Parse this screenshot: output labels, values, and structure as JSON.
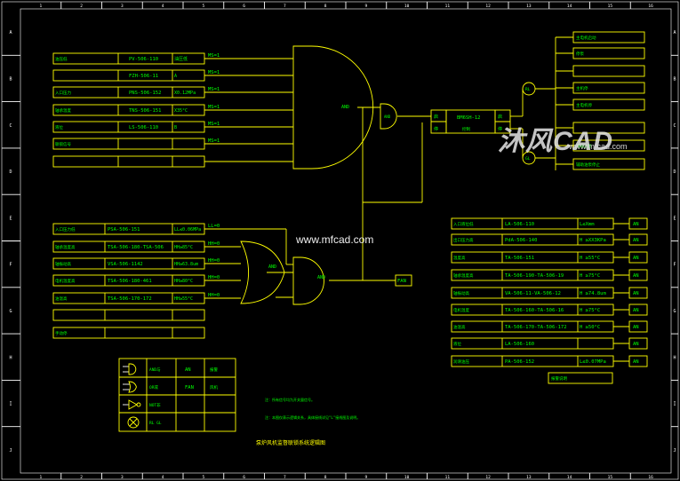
{
  "colors": {
    "background": "#000000",
    "line": "#ffff00",
    "text": "#00ff00",
    "frame": "#ffffff",
    "cyan": "#00ffff",
    "red": "#ff3030",
    "watermark": "#e8e8e8"
  },
  "border": {
    "top_numbers": [
      "1",
      "2",
      "3",
      "4",
      "5",
      "6",
      "7",
      "8",
      "9",
      "10",
      "11",
      "12",
      "13",
      "14",
      "15",
      "16"
    ],
    "bottom_numbers": [
      "1",
      "2",
      "3",
      "4",
      "5",
      "6",
      "7",
      "8",
      "9",
      "10",
      "11",
      "12",
      "13",
      "14",
      "15",
      "16"
    ],
    "side_letters": [
      "A",
      "B",
      "C",
      "D",
      "E",
      "F",
      "G",
      "H",
      "I",
      "J"
    ]
  },
  "upper_group": {
    "rows": [
      {
        "name": "油压低",
        "tag": "PV-506-110",
        "cond": "油压低",
        "ms": "MS=1"
      },
      {
        "name": "",
        "tag": "FZH-506-11",
        "cond": "A",
        "ms": "MS=1"
      },
      {
        "name": "入口压力",
        "tag": "PNS-506-152",
        "cond": "X0.12MPa",
        "ms": "MS=1"
      },
      {
        "name": "轴承温度",
        "tag": "TNS-506-151",
        "cond": "X35°C",
        "ms": "MS=1"
      },
      {
        "name": "液位",
        "tag": "LS-506-110",
        "cond": "B",
        "ms": "MS=1"
      },
      {
        "name": "联锁信号",
        "tag": "",
        "cond": "",
        "ms": "MS=1"
      },
      {
        "name": "",
        "tag": "",
        "cond": "",
        "ms": ""
      }
    ],
    "gate_label": "AND"
  },
  "lower_group": {
    "rows": [
      {
        "name": "入口压力低",
        "tag": "PSA-506-151",
        "cond": "LL≤0.06MPa",
        "ms": "LL=0"
      },
      {
        "name": "轴承温度高",
        "tag": "TSA-506-180-TSA-506",
        "cond": "HH≥85°C",
        "ms": "HH=0"
      },
      {
        "name": "轴振动高",
        "tag": "VSA-506-1142",
        "cond": "HH≥63.8um",
        "ms": "HH=0"
      },
      {
        "name": "电机温度高",
        "tag": "TSA-506-180-461",
        "cond": "HH≥80°C",
        "ms": "HH=0"
      },
      {
        "name": "油温高",
        "tag": "TSA-506-170-172",
        "cond": "HH≥55°C",
        "ms": "HH=0"
      },
      {
        "name": "",
        "tag": "",
        "cond": "",
        "ms": ""
      },
      {
        "name": "手动停",
        "tag": "",
        "cond": "",
        "ms": ""
      }
    ],
    "or_gate_label": "AND",
    "and_gate_label": "AND",
    "fan_label": "FAN"
  },
  "center": {
    "and_gate_label": "AND",
    "controller_left_top": "启",
    "controller_left_bottom": "停",
    "controller_tag": "BM6SH-12",
    "controller_sub": "控制",
    "controller_right_top": "启",
    "controller_right_bottom": "停",
    "lamp_top": "RL",
    "lamp_bottom": "GL"
  },
  "output_list": [
    "主电机启动",
    "停泵",
    "",
    "主机停",
    "主电机停",
    "",
    "辅助油泵",
    "辅助油泵停止"
  ],
  "alarm_group": {
    "rows": [
      {
        "name": "入口液位低",
        "tag": "LA-506-110",
        "cond": "L≤Xmm",
        "out": "AN"
      },
      {
        "name": "出口压力高",
        "tag": "PdA-506-140",
        "cond": "H ≥XX3KPa",
        "out": "AN"
      },
      {
        "name": "温度高",
        "tag": "TA-506-151",
        "cond": "H ≥55°C",
        "out": "AN"
      },
      {
        "name": "轴承温度高",
        "tag": "TA-506-190-TA-506-19",
        "cond": "H ≥75°C",
        "out": "AN"
      },
      {
        "name": "轴振动高",
        "tag": "VA-506-11-VA-506-12",
        "cond": "H ≥74.8um",
        "out": "AN"
      },
      {
        "name": "电机温度",
        "tag": "TA-506-160-TA-506-16",
        "cond": "H ≥75°C",
        "out": "AN"
      },
      {
        "name": "油温高",
        "tag": "TA-506-170-TA-506-172",
        "cond": "H ≥50°C",
        "out": "AN"
      },
      {
        "name": "液位",
        "tag": "LA-506-160",
        "cond": "",
        "out": "AN"
      },
      {
        "name": "润滑油压",
        "tag": "PA-506-152",
        "cond": "L≤0.07MPa",
        "out": "AN"
      }
    ],
    "footer": "报警说明"
  },
  "legend": {
    "rows": [
      {
        "symbol": "AND",
        "label": "AND与",
        "abbr": "AN",
        "desc": "报警"
      },
      {
        "symbol": "OR",
        "label": "OR或",
        "abbr": "FAN",
        "desc": "风机"
      },
      {
        "symbol": "NOT",
        "label": "NOT非",
        "abbr": "",
        "desc": ""
      },
      {
        "symbol": "LAMP",
        "label": "RL\nGL",
        "abbr": "",
        "desc": ""
      }
    ]
  },
  "notes": [
    "注：所有信号均为开关量信号。",
    "注：本图仅表示逻辑关系，具体接线详见\"L\"接线图及说明。"
  ],
  "title": "泵炉风机监督联锁系统逻辑图",
  "watermarks": {
    "cad_logo": "沐风CAD",
    "url_center": "www.mfcad.com",
    "url_right": "www.mfcad.com"
  }
}
